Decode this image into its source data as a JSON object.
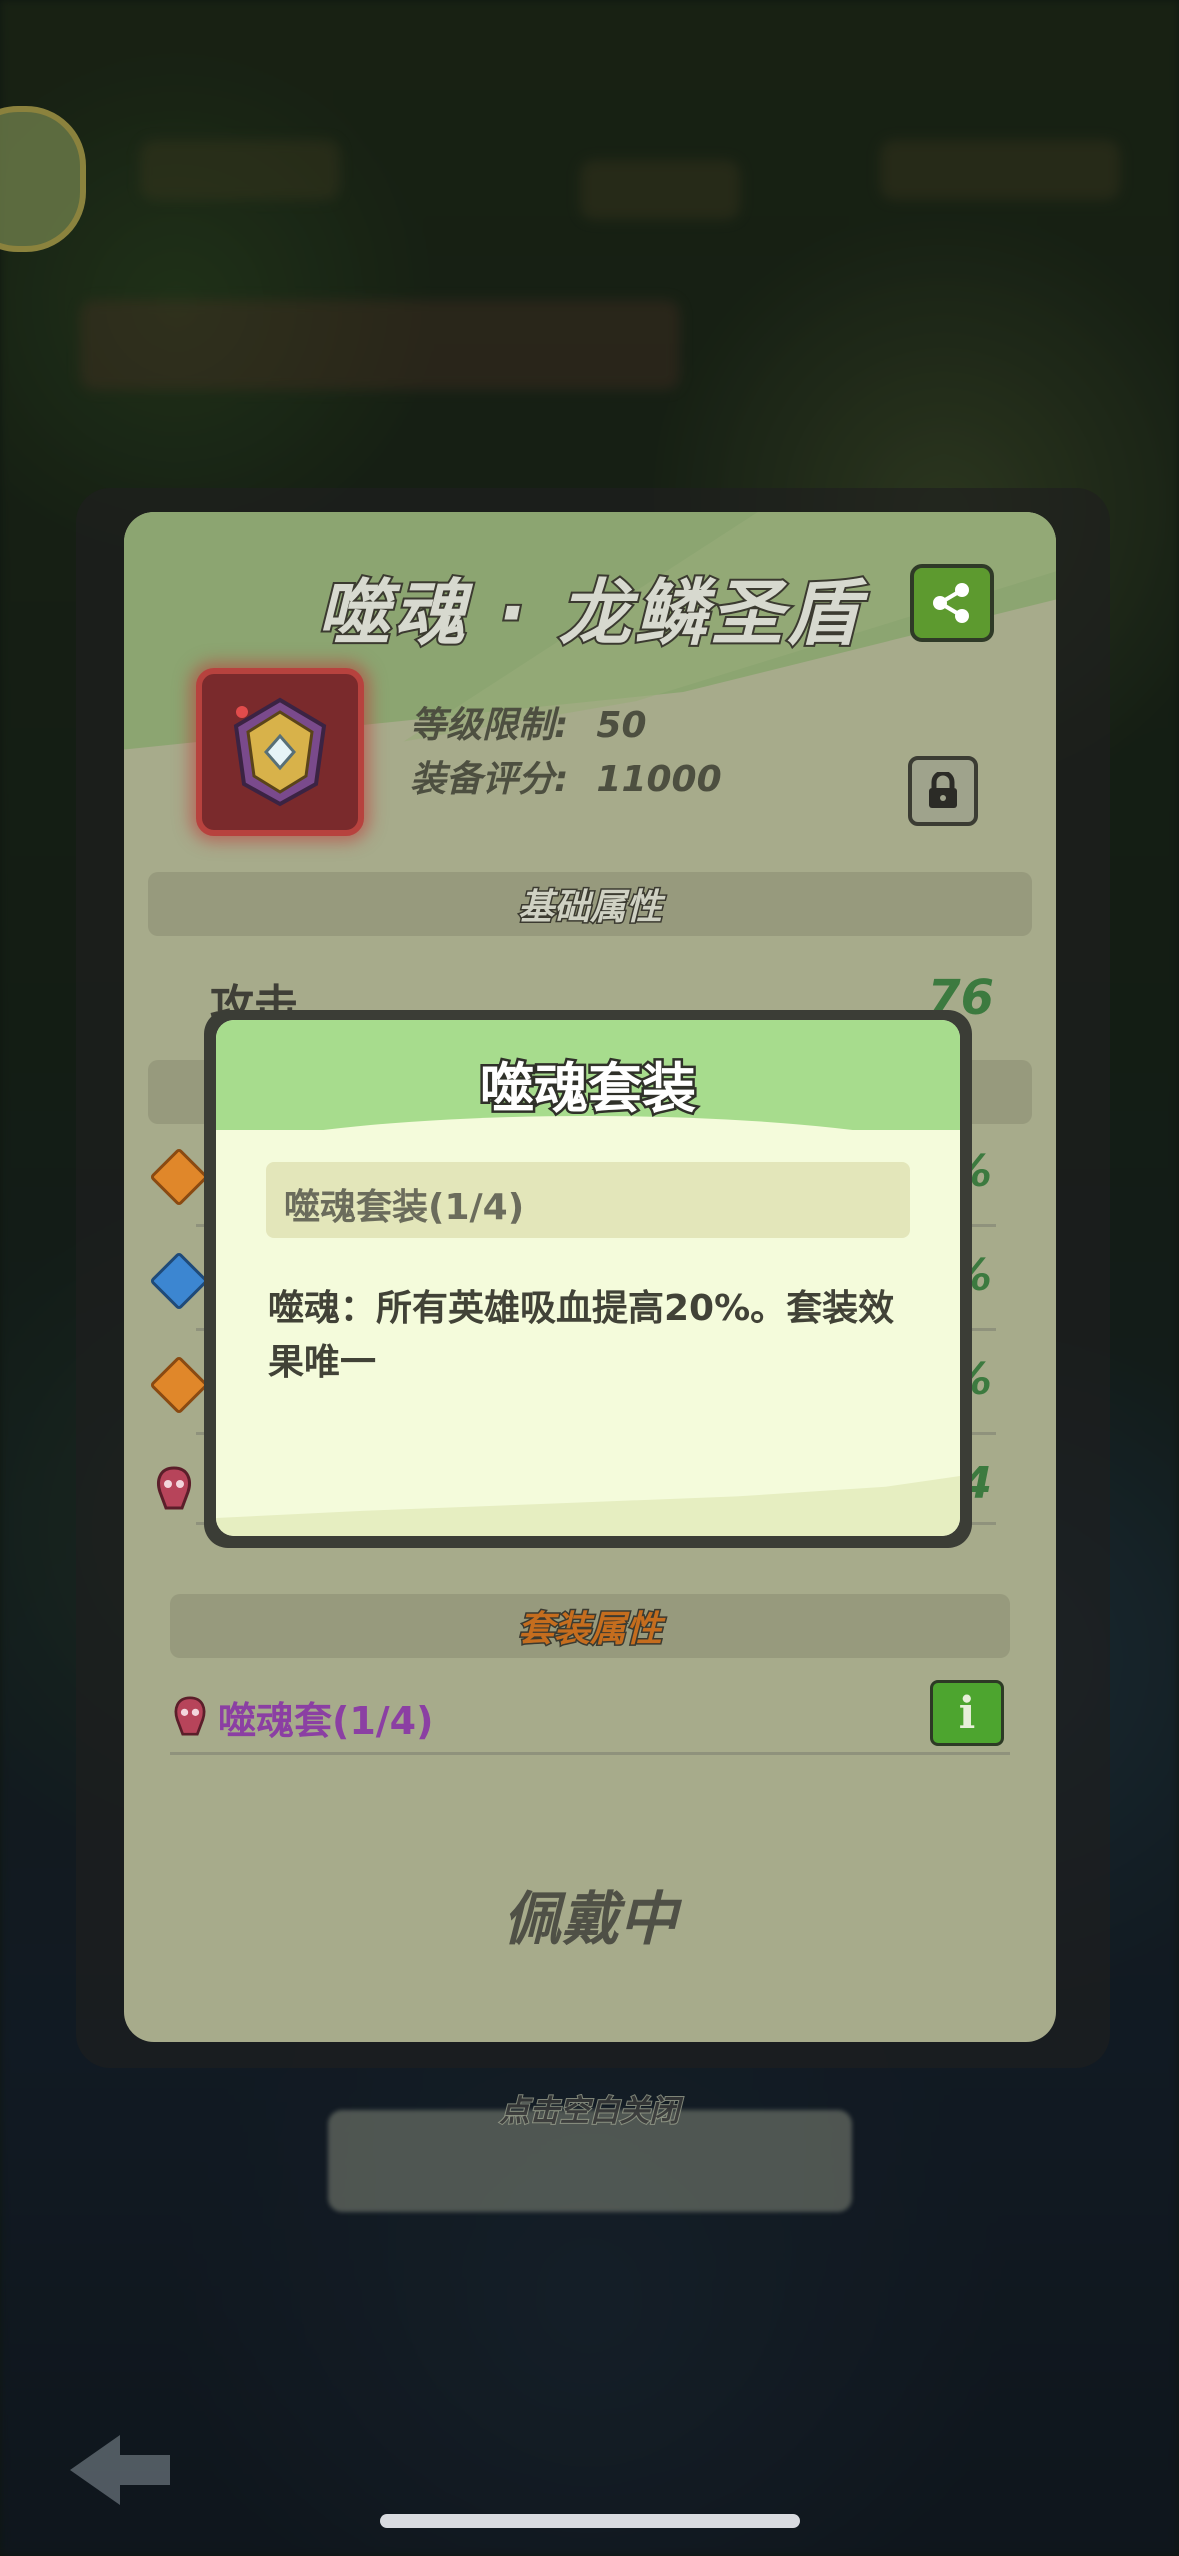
{
  "item": {
    "name": "噬魂 · 龙鳞圣盾",
    "level_label": "等级限制:",
    "level_value": "50",
    "score_label": "装备评分:",
    "score_value": "11000"
  },
  "sections": {
    "basic": "基础属性",
    "set": "套装属性"
  },
  "basic_attrs": [
    {
      "name": "攻击",
      "value": "76"
    }
  ],
  "hidden_rows": [
    {
      "tail": "%",
      "gem": "orange"
    },
    {
      "tail": "%",
      "gem": "blue"
    },
    {
      "tail": "%",
      "gem": "orange"
    },
    {
      "tail": "4",
      "gem": "set"
    }
  ],
  "set_row": {
    "label": "噬魂套(1/4)"
  },
  "status": {
    "equipped": "佩戴中",
    "close_hint": "点击空白关闭"
  },
  "popup": {
    "title": "噬魂套装",
    "set_count": "噬魂套装(1/4)",
    "description": "噬魂：所有英雄吸血提高20%。套装效果唯一"
  },
  "colors": {
    "panel": "#a7ab8b",
    "attr_value": "#3c7a3f",
    "set_label": "#8b3fa3",
    "popup_head": "#a7dc8d",
    "popup_body": "#f4fbdb"
  },
  "icons": {
    "share": "share-icon",
    "lock": "lock-icon",
    "info": "info-icon",
    "item": "dragon-scale-shield-icon"
  }
}
